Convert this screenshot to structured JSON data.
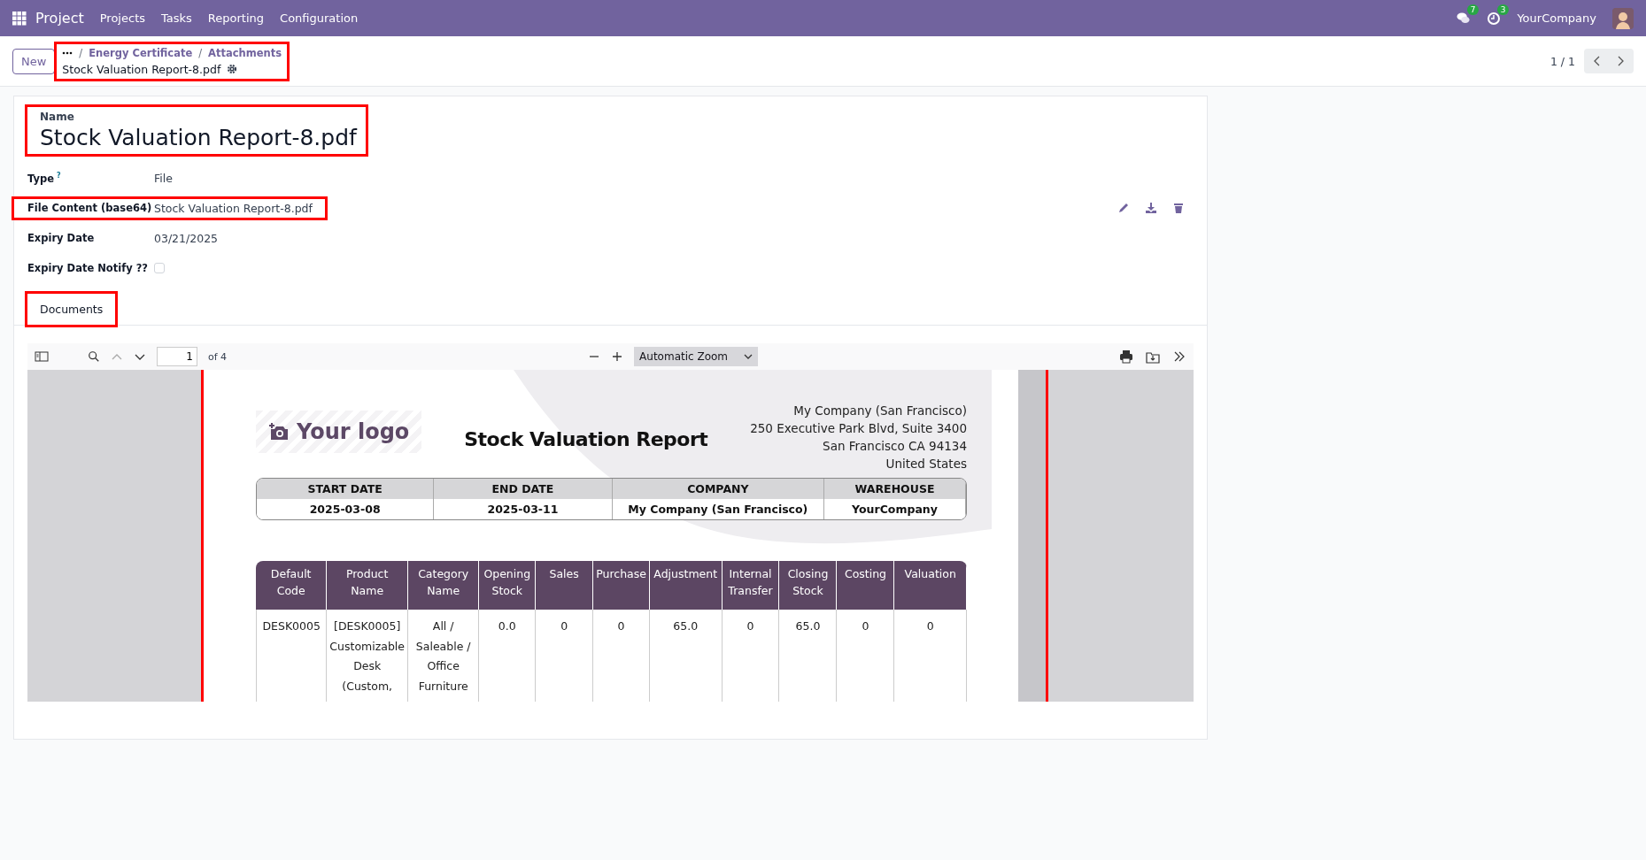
{
  "navbar": {
    "app": "Project",
    "menu": [
      "Projects",
      "Tasks",
      "Reporting",
      "Configuration"
    ],
    "messages_badge": "7",
    "activities_badge": "3",
    "company": "YourCompany"
  },
  "control_panel": {
    "new_button": "New",
    "breadcrumbs": [
      {
        "separator": "/",
        "label": "Energy Certificate"
      },
      {
        "separator": "/",
        "label": "Attachments"
      }
    ],
    "current": "Stock Valuation Report-8.pdf",
    "highlighted": true,
    "pager": "1 / 1"
  },
  "form": {
    "name_label": "Name",
    "name": "Stock Valuation Report-8.pdf",
    "name_highlighted": true,
    "fields": [
      {
        "kind": "text",
        "label": "Type",
        "help": "?",
        "value": "File",
        "highlighted": false
      },
      {
        "kind": "text",
        "label": "File Content (base64)",
        "value": "Stock Valuation Report-8.pdf",
        "highlighted": true
      },
      {
        "kind": "text",
        "label": "Expiry Date",
        "value": "03/21/2025",
        "highlighted": false
      },
      {
        "kind": "checkbox",
        "label": "Expiry Date Notify ??",
        "checked": false,
        "highlighted": false
      }
    ],
    "tabs": [
      {
        "label": "Documents",
        "selected": true,
        "highlighted": true
      }
    ]
  },
  "pdf_viewer": {
    "page": "1",
    "of": "of 4",
    "zoom": "Automatic Zoom",
    "highlighted": true,
    "document": {
      "logo": "Your logo",
      "title": "Stock Valuation Report",
      "address": [
        "My Company (San Francisco)",
        "250 Executive Park Blvd, Suite 3400",
        "San Francisco CA 94134",
        "United States"
      ],
      "info_columns": [
        "START DATE",
        "END DATE",
        "COMPANY",
        "WAREHOUSE"
      ],
      "info_values": [
        "2025-03-08",
        "2025-03-11",
        "My Company (San Francisco)",
        "YourCompany"
      ],
      "columns": [
        "Default Code",
        "Product Name",
        "Category Name",
        "Opening Stock",
        "Sales",
        "Purchase",
        "Adjustment",
        "Internal Transfer",
        "Closing Stock",
        "Costing",
        "Valuation"
      ],
      "rows": [
        [
          "DESK0005",
          "[DESK0005] Customizable Desk (Custom,",
          "All / Saleable / Office Furniture",
          "0.0",
          "0",
          "0",
          "65.0",
          "0",
          "65.0",
          "0",
          "0"
        ]
      ]
    }
  }
}
